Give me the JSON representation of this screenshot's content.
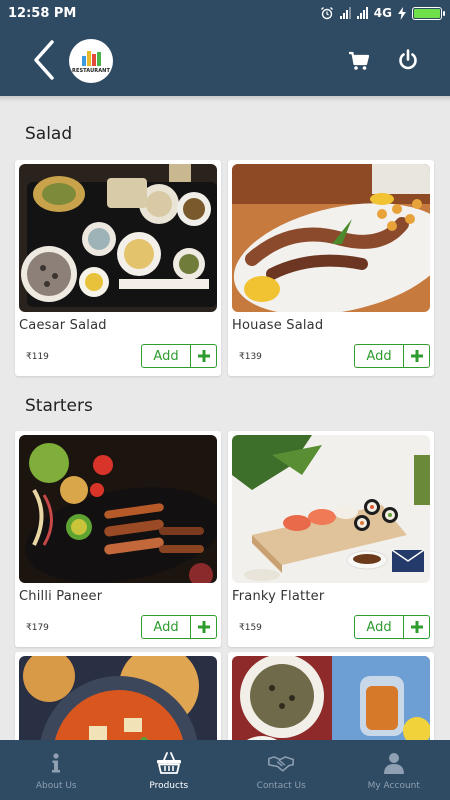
{
  "status_bar": {
    "time": "12:58 PM",
    "network": "4G",
    "battery_level": 0.95,
    "battery_color": "#6fe04a",
    "icons": [
      "alarm-icon",
      "signal-icon",
      "signal-icon",
      "battery-icon"
    ]
  },
  "header": {
    "background": "#2f4a63",
    "logo_text": "RESTAURANT",
    "icons": [
      "back-arrow-icon",
      "cart-icon",
      "power-icon"
    ]
  },
  "sections": [
    {
      "title": "Salad",
      "items": [
        {
          "name": "Caesar Salad",
          "price": "₹119",
          "add_label": "Add"
        },
        {
          "name": "Houase Salad",
          "price": "₹139",
          "add_label": "Add"
        }
      ]
    },
    {
      "title": "Starters",
      "items": [
        {
          "name": "Chilli Paneer",
          "price": "₹179",
          "add_label": "Add"
        },
        {
          "name": "Franky Flatter",
          "price": "₹159",
          "add_label": "Add"
        }
      ]
    }
  ],
  "bottom_nav": {
    "items": [
      {
        "label": "About Us",
        "icon": "info-icon",
        "active": false
      },
      {
        "label": "Products",
        "icon": "basket-icon",
        "active": true
      },
      {
        "label": "Contact Us",
        "icon": "handshake-icon",
        "active": false
      },
      {
        "label": "My Account",
        "icon": "user-icon",
        "active": false
      }
    ]
  },
  "colors": {
    "accent_green": "#2e9c2e",
    "nav_inactive": "#8ea0b2",
    "nav_active": "#ffffff"
  }
}
